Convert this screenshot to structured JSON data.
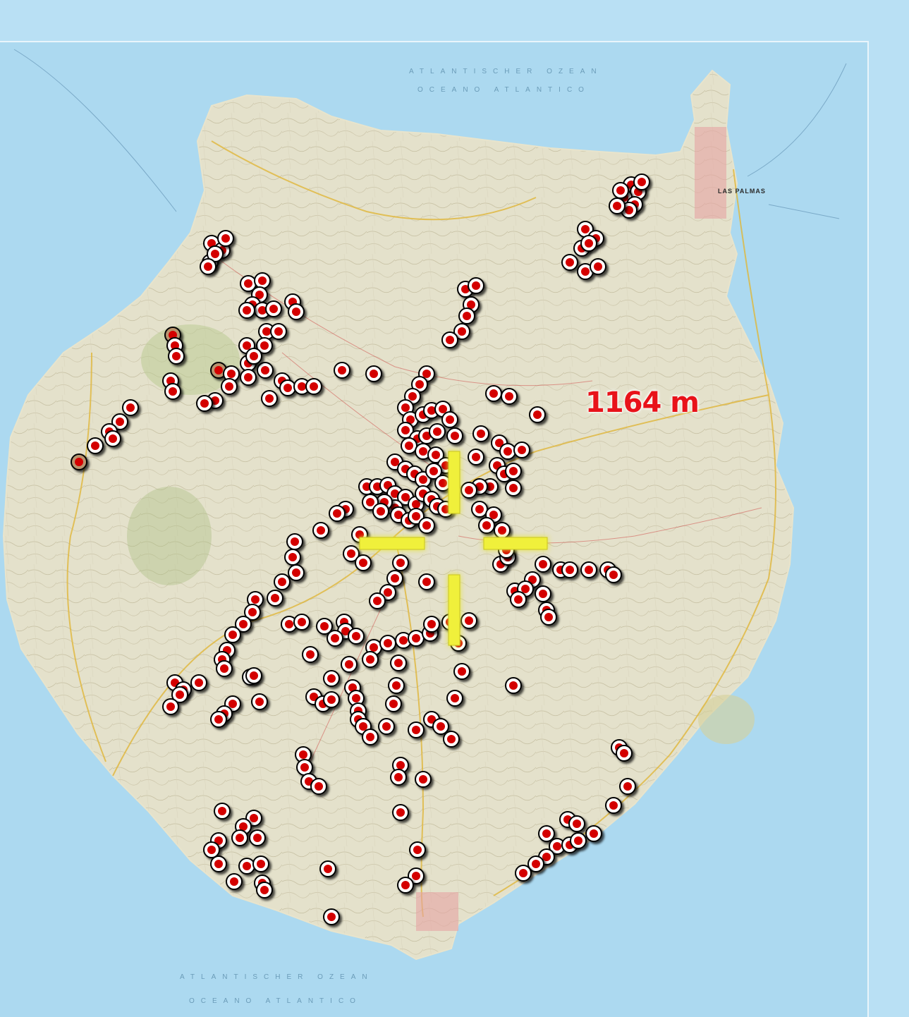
{
  "map": {
    "ocean_labels": {
      "top_line_1": "ATLANTISCHER OZEAN",
      "top_line_2": "OCEANO ATLANTICO",
      "bottom_line_1": "ATLANTISCHER OZEAN",
      "bottom_line_2": "OCEANO ATLANTICO"
    },
    "place_label": "LAS PALMAS",
    "elevation_label": "1164 m",
    "colors": {
      "ocean": "#acd9f0",
      "land": "#e6e3cf",
      "marker_fill": "#d40000",
      "marker_ring": "#ffffff",
      "marker_outline": "#000000",
      "marker_ring_alt": "#b8946e",
      "crosshair": "#f0f03a",
      "elevation_text": "#e8121a"
    },
    "crosshair_icon": "crosshair-target-icon",
    "marker_icon": "map-pin-dot-icon"
  }
}
